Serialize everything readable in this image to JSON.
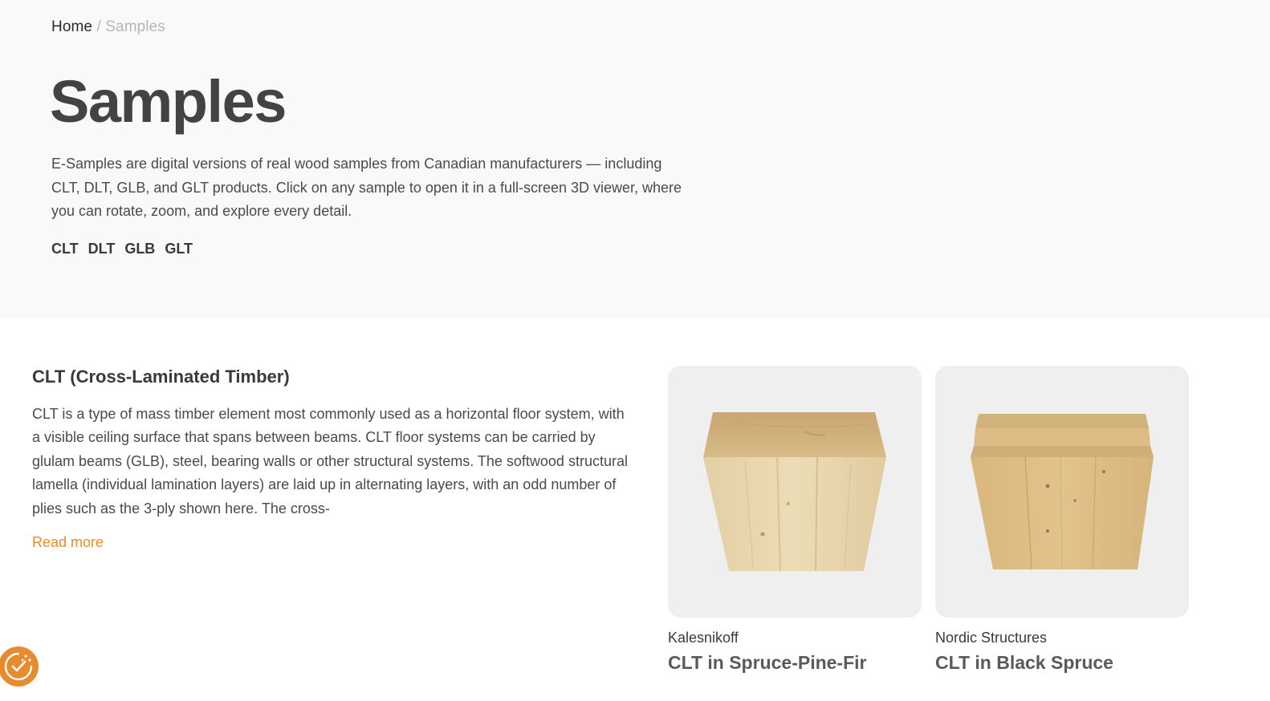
{
  "breadcrumb": {
    "home": "Home",
    "separator": "/",
    "current": "Samples"
  },
  "page": {
    "title": "Samples",
    "intro": "E-Samples are digital versions of real wood samples from Canadian manufacturers — including CLT, DLT, GLB, and GLT products. Click on any sample to open it in a full-screen 3D viewer, where you can rotate, zoom, and explore every detail."
  },
  "filters": [
    "CLT",
    "DLT",
    "GLB",
    "GLT"
  ],
  "section": {
    "title": "CLT (Cross-Laminated Timber)",
    "body": "CLT is a type of mass timber element most commonly used as a horizontal floor system, with a visible ceiling surface that spans between beams.  CLT floor systems can be carried by glulam beams (GLB), steel, bearing walls or other structural systems. The softwood structural lamella (individual lamination layers) are laid up in alternating layers, with an odd number of plies such as the 3-ply shown here. The cross-",
    "read_more": "Read more"
  },
  "samples": [
    {
      "manufacturer": "Kalesnikoff",
      "name": "CLT in Spruce-Pine-Fir",
      "thumbnail": "wood-block-light"
    },
    {
      "manufacturer": "Nordic Structures",
      "name": "CLT in Black Spruce",
      "thumbnail": "wood-block-golden"
    }
  ],
  "colors": {
    "accent": "#f08a24",
    "hero_background": "#f9f9f9",
    "card_background": "#efefef",
    "consent_badge": "#e88a2e"
  },
  "icons": {
    "consent": "cookie-check-icon"
  }
}
